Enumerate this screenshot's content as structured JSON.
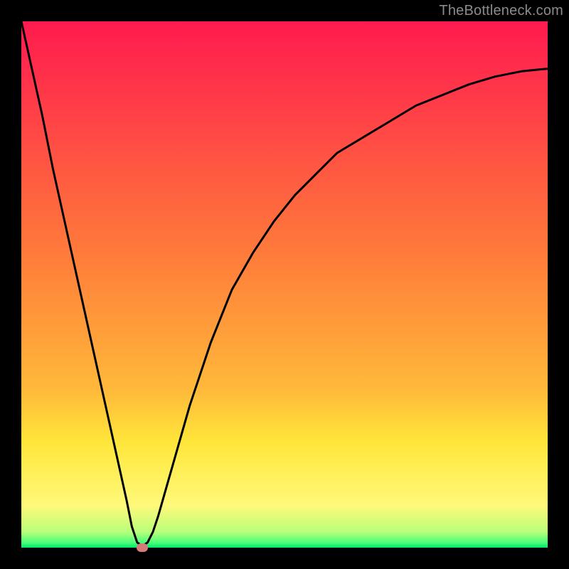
{
  "watermark": "TheBottleneck.com",
  "colors": {
    "top": "#ff1a4f",
    "mid1": "#ff7d3a",
    "mid2": "#ffb93a",
    "yellow": "#ffe63a",
    "lowyellow": "#fff97a",
    "green1": "#b9ff7a",
    "green2": "#4dff7a",
    "green3": "#00e86b",
    "curve": "#000000",
    "marker": "#d77a7a"
  },
  "chart_data": {
    "type": "line",
    "title": "",
    "xlabel": "",
    "ylabel": "",
    "xlim": [
      0,
      100
    ],
    "ylim": [
      0,
      100
    ],
    "series": [
      {
        "name": "curve",
        "x": [
          0,
          2,
          4,
          6,
          8,
          10,
          12,
          14,
          16,
          18,
          20,
          21,
          22,
          23,
          24,
          25,
          26,
          28,
          30,
          32,
          34,
          36,
          38,
          40,
          44,
          48,
          52,
          56,
          60,
          65,
          70,
          75,
          80,
          85,
          90,
          95,
          100
        ],
        "y": [
          100,
          91,
          82,
          72,
          63,
          54,
          45,
          36,
          27,
          18,
          9,
          4,
          1,
          0.3,
          1,
          3,
          6,
          13,
          20,
          27,
          33,
          39,
          44,
          49,
          56,
          62,
          67,
          71,
          75,
          78,
          81,
          84,
          86,
          88,
          89.5,
          90.5,
          91
        ]
      }
    ],
    "marker": {
      "x": 23,
      "y": 0
    }
  }
}
